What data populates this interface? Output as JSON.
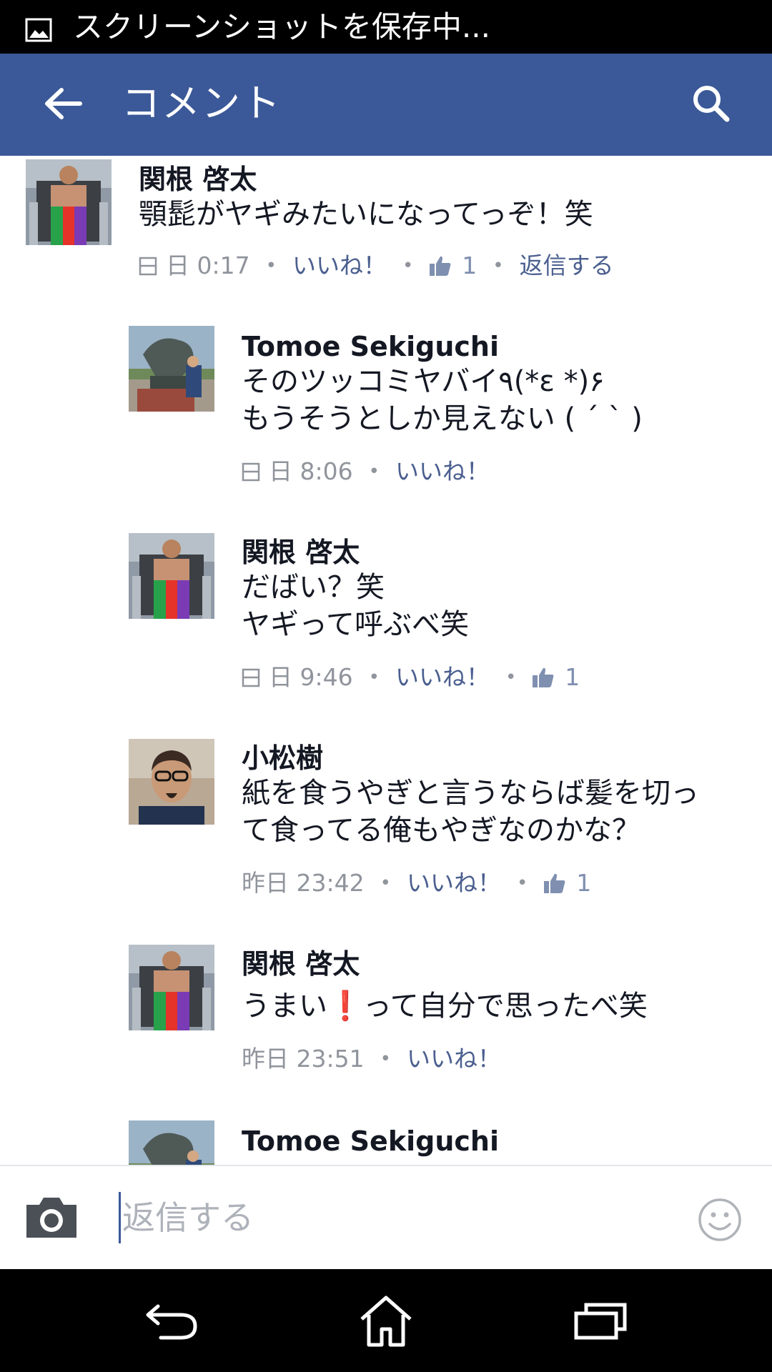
{
  "status_bar": {
    "text": "スクリーンショットを保存中..."
  },
  "app_bar": {
    "title": "コメント",
    "back_icon": "back-arrow-icon",
    "search_icon": "search-icon"
  },
  "comments": [
    {
      "author": "関根 啓太",
      "lines": [
        "顎髭がヤギみたいになってっぞ！笑"
      ],
      "time": "日 0:17",
      "like_label": "いいね！",
      "likes": "1",
      "reply_label": "返信する"
    },
    {
      "author": "Tomoe Sekiguchi",
      "lines": [
        "そのツッコミヤバイ٩(*ɛ *)۶",
        "もうそうとしか見えない ( ´ ` )"
      ],
      "time": "日 8:06",
      "like_label": "いいね！"
    },
    {
      "author": "関根 啓太",
      "lines": [
        "だばい？笑",
        "ヤギって呼ぶべ笑"
      ],
      "time": "日 9:46",
      "like_label": "いいね！",
      "likes": "1"
    },
    {
      "author": "小松樹",
      "lines": [
        "紙を食うやぎと言うならば髪を切っ",
        "て食ってる俺もやぎなのかな？"
      ],
      "time": "昨日 23:42",
      "like_label": "いいね！",
      "likes": "1"
    },
    {
      "author": "関根 啓太",
      "line_before": "うまい",
      "emoji": "❗",
      "line_after": "って自分で思ったべ笑",
      "time": "昨日 23:51",
      "like_label": "いいね！"
    },
    {
      "author": "Tomoe Sekiguchi"
    }
  ],
  "reply_bar": {
    "placeholder": "返信する"
  },
  "colors": {
    "facebook_blue": "#3b5998",
    "link": "#4b5f8f",
    "meta_gray": "#90949c"
  }
}
